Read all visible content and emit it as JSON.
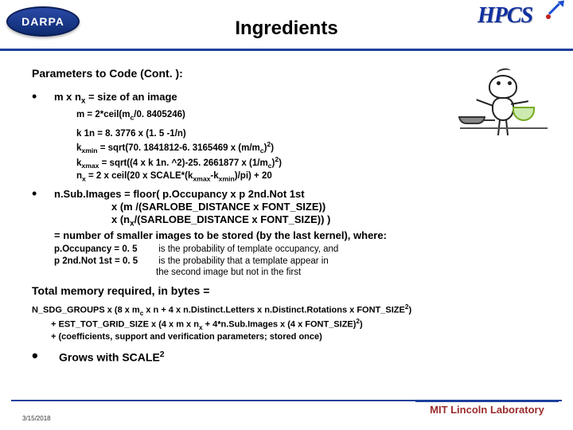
{
  "header": {
    "logo_left": "DARPA",
    "title": "Ingredients",
    "logo_right": "HPCS"
  },
  "subtitle": "Parameters to Code (Cont. ):",
  "bullet1": {
    "line": "m x n<sub>x</sub> = size of an image",
    "sub1": "m = 2*ceil(m<sub>c</sub>/0. 8405246)",
    "sub2": "k 1n = 8. 3776 x (1. 5 -1/n)",
    "sub3": "k<sub>xmin</sub> = sqrt(70. 1841812-6. 3165469 x (m/m<sub>c</sub>)<sup>2</sup>)",
    "sub4": "k<sub>xmax</sub> = sqrt((4 x k 1n. ^2)-25. 2661877 x (1/m<sub>c</sub>)<sup>2</sup>)",
    "sub5": "n<sub>x</sub> = 2 x ceil(20 x SCALE*(k<sub>xmax</sub>-k<sub>xmin</sub>)/pi) + 20"
  },
  "bullet2": {
    "l1": "n.Sub.Images = floor( p.Occupancy x p 2nd.Not 1st",
    "l2": "x (m /(SARLOBE_DISTANCE x FONT_SIZE))",
    "l3": "x (n<sub>x</sub>/(SARLOBE_DISTANCE x FONT_SIZE)) )",
    "l4": "= number of smaller images to be stored (by the last kernel), where:",
    "p1_label": "p.Occupancy = 0. 5",
    "p1_desc": "is the probability of template occupancy, and",
    "p2_label": "p 2nd.Not 1st  = 0. 5",
    "p2_desc_a": "is the probability that a template appear in",
    "p2_desc_b": "the second image but not in the first"
  },
  "total_label": "Total memory required, in bytes =",
  "mem": {
    "l1": "N_SDG_GROUPS x (8 x m<sub>c</sub> x n + 4 x n.Distinct.Letters x n.Distinct.Rotations x FONT_SIZE<sup>2</sup>)",
    "l2": "+ EST_TOT_GRID_SIZE x (4 x m x n<sub>x</sub> + 4*n.Sub.Images x (4 x FONT_SIZE)<sup>2</sup>)",
    "l3": "+ (coefficients, support and verification parameters; stored once)"
  },
  "grows": "Grows with SCALE<sup>2</sup>",
  "footer_left": "3/15/2018",
  "footer_right": "MIT Lincoln Laboratory"
}
